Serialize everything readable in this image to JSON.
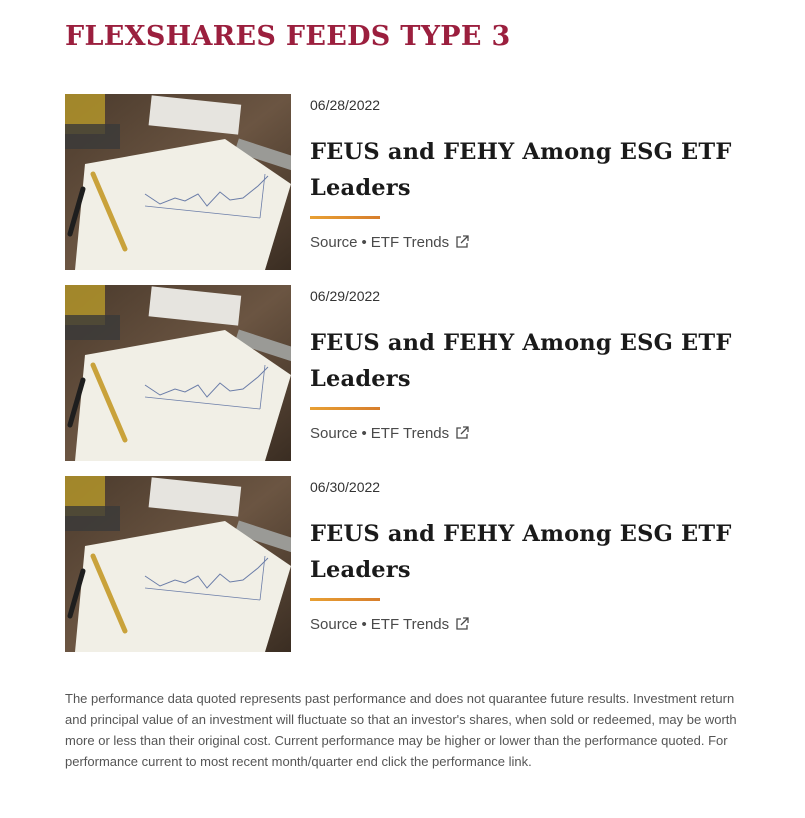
{
  "page": {
    "title": "FLEXSHARES FEEDS TYPE 3"
  },
  "feeds": [
    {
      "date": "06/28/2022",
      "headline": "FEUS and FEHY Among ESG ETF Leaders",
      "source_label": "Source",
      "separator": "•",
      "source_name": "ETF Trends",
      "thumbnail_icon": "chart-on-paper-image",
      "link_icon": "external-link-icon"
    },
    {
      "date": "06/29/2022",
      "headline": "FEUS and FEHY Among ESG ETF Leaders",
      "source_label": "Source",
      "separator": "•",
      "source_name": "ETF Trends",
      "thumbnail_icon": "chart-on-paper-image",
      "link_icon": "external-link-icon"
    },
    {
      "date": "06/30/2022",
      "headline": "FEUS and FEHY Among ESG ETF Leaders",
      "source_label": "Source",
      "separator": "•",
      "source_name": "ETF Trends",
      "thumbnail_icon": "chart-on-paper-image",
      "link_icon": "external-link-icon"
    }
  ],
  "disclaimer": "The performance data quoted represents past performance and does not quarantee future results. Investment return and principal value of an investment will fluctuate so that an investor's shares, when sold or redeemed, may be worth more or less than their original cost. Current performance may be higher or lower than the performance quoted. For performance current to most recent month/quarter end click the performance link.",
  "colors": {
    "title": "#9b1f3e",
    "accent_rule_start": "#e8a033",
    "accent_rule_end": "#d77e2c",
    "headline": "#1a1a1a",
    "body_text": "#555555"
  }
}
